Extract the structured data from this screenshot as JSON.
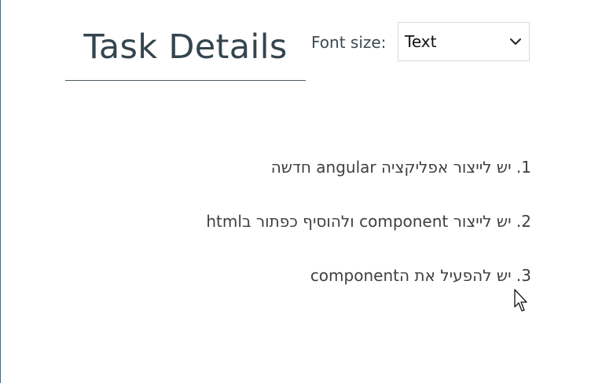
{
  "header": {
    "title": "Task Details"
  },
  "font_control": {
    "label": "Font size:",
    "selected_value": "Text"
  },
  "steps": [
    {
      "text": "1. יש לייצור אפליקציה angular חדשה"
    },
    {
      "text": "2. יש לייצור component ולהוסיף כפתור בhtml"
    },
    {
      "text": "3. יש להפעיל את הcomponent"
    }
  ],
  "colors": {
    "title": "#34454e",
    "step_text": "#3f3f3f",
    "divider": "#4b5a62"
  }
}
